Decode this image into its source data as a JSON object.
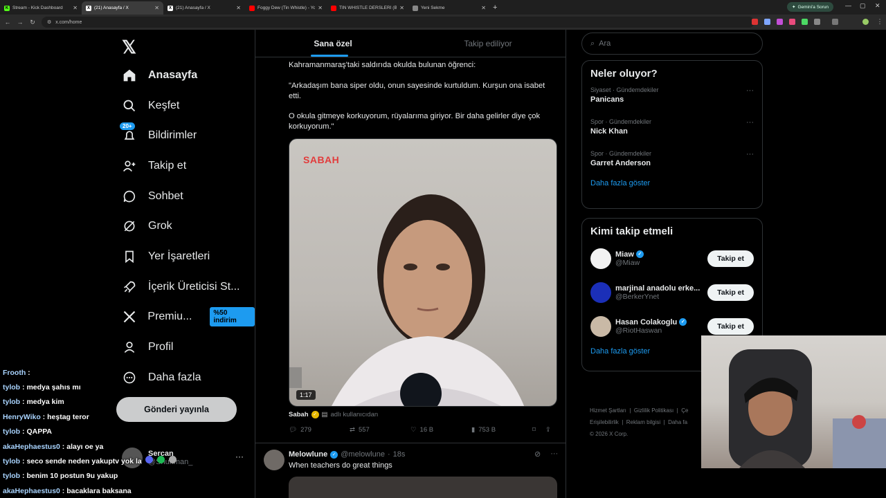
{
  "browser": {
    "tabs": [
      {
        "label": "Stream - Kick Dashboard",
        "active": false,
        "favicon_color": "#53fc18",
        "favicon_glyph": "K"
      },
      {
        "label": "(21) Anasayfa / X",
        "active": true,
        "favicon_color": "#ffffff",
        "favicon_glyph": "X"
      },
      {
        "label": "(21) Anasayfa / X",
        "active": false,
        "favicon_color": "#ffffff",
        "favicon_glyph": "X"
      },
      {
        "label": "Foggy Dew (Tin Whistle) - YouT",
        "active": false,
        "favicon_color": "#ff0000",
        "favicon_glyph": ""
      },
      {
        "label": "TIN WHISTLE DERSLERİ (B",
        "active": false,
        "favicon_color": "#ff0000",
        "favicon_glyph": ""
      },
      {
        "label": "Yeni Sekme",
        "active": false,
        "favicon_color": "#888888",
        "favicon_glyph": ""
      }
    ],
    "gemini_label": "Gemini'a Sorun",
    "url": "x.com/home"
  },
  "sidebar": {
    "items": [
      {
        "label": "Anasayfa",
        "icon": "home-icon",
        "active": true
      },
      {
        "label": "Keşfet",
        "icon": "search-icon"
      },
      {
        "label": "Bildirimler",
        "icon": "bell-icon",
        "badge": "20+"
      },
      {
        "label": "Takip et",
        "icon": "add-user-icon"
      },
      {
        "label": "Sohbet",
        "icon": "chat-icon"
      },
      {
        "label": "Grok",
        "icon": "grok-icon"
      },
      {
        "label": "Yer İşaretleri",
        "icon": "bookmark-icon"
      },
      {
        "label": "İçerik Üreticisi St...",
        "icon": "rocket-icon"
      },
      {
        "label": "Premiu...",
        "icon": "x-logo-icon",
        "discount": "%50 indirim"
      },
      {
        "label": "Profil",
        "icon": "profile-icon"
      },
      {
        "label": "Daha fazla",
        "icon": "more-circle-icon"
      }
    ],
    "post_button": "Gönderi yayınla",
    "account": {
      "name": "Sercan",
      "handle": "@Shuriman_"
    }
  },
  "feed": {
    "tabs": [
      "Sana özel",
      "Takip ediliyor"
    ],
    "tweet": {
      "lines": [
        "Kahramanmaraş'taki saldırıda okulda bulunan öğrenci:",
        "\"Arkadaşım bana siper oldu, onun sayesinde kurtuldum. Kurşun ona isabet etti.",
        "O okula gitmeye korkuyorum, rüyalarıma giriyor. Bir daha gelirler diye çok korkuyorum.\""
      ],
      "media_watermark": "SABAH",
      "video_duration": "1:17",
      "source_name": "Sabah",
      "source_suffix": "adlı kullanıcıdan",
      "replies": "279",
      "reposts": "557",
      "likes": "16 B",
      "views": "753 B"
    },
    "tweet2": {
      "name": "Melowlune",
      "handle": "@melowlune",
      "time": "18s",
      "text": "When teachers do great things"
    }
  },
  "right": {
    "search_placeholder": "Ara",
    "trends_title": "Neler oluyor?",
    "trends": [
      {
        "meta": "Siyaset · Gündemdekiler",
        "name": "Panicans"
      },
      {
        "meta": "Spor · Gündemdekiler",
        "name": "Nick Khan"
      },
      {
        "meta": "Spor · Gündemdekiler",
        "name": "Garret Anderson"
      }
    ],
    "show_more": "Daha fazla göster",
    "follow_title": "Kimi takip etmeli",
    "follow": [
      {
        "name": "Miaw",
        "handle": "@Miaw",
        "verified": true,
        "avatar_color": "#f2f2f2"
      },
      {
        "name": "marjinal anadolu erke...",
        "handle": "@BerkerYnet",
        "verified": false,
        "avatar_color": "#1b2fb8"
      },
      {
        "name": "Hasan Colakoglu",
        "handle": "@RiotHaswan",
        "verified": true,
        "avatar_color": "#c9b9a6"
      }
    ],
    "follow_button": "Takip et",
    "footer": {
      "line1": [
        "Hizmet Şartları",
        "Gizlilik Politikası",
        "Çe"
      ],
      "line2": [
        "Erişilebilirlik",
        "Reklam bilgisi",
        "Daha fa"
      ],
      "copyright": "© 2026 X Corp."
    }
  },
  "chat": [
    {
      "user": "Frooth",
      "msg": ""
    },
    {
      "user": "tylob",
      "msg": "medya şahıs mı"
    },
    {
      "user": "tylob",
      "msg": "medya kim"
    },
    {
      "user": "HenryWiko",
      "msg": "heştag teror"
    },
    {
      "user": "tylob",
      "msg": "QAPPA"
    },
    {
      "user": "akaHephaestus0",
      "msg": "alayı oe ya"
    },
    {
      "user": "tylob",
      "msg": "seco sende neden yakuptv yok la"
    },
    {
      "user": "tylob",
      "msg": "benim 10 postun 9u yakup"
    },
    {
      "user": "akaHephaestus0",
      "msg": "bacaklara baksana"
    }
  ],
  "colors": {
    "accent": "#1d9bf0",
    "background": "#000000",
    "border": "#2f3336",
    "muted": "#71767b"
  }
}
